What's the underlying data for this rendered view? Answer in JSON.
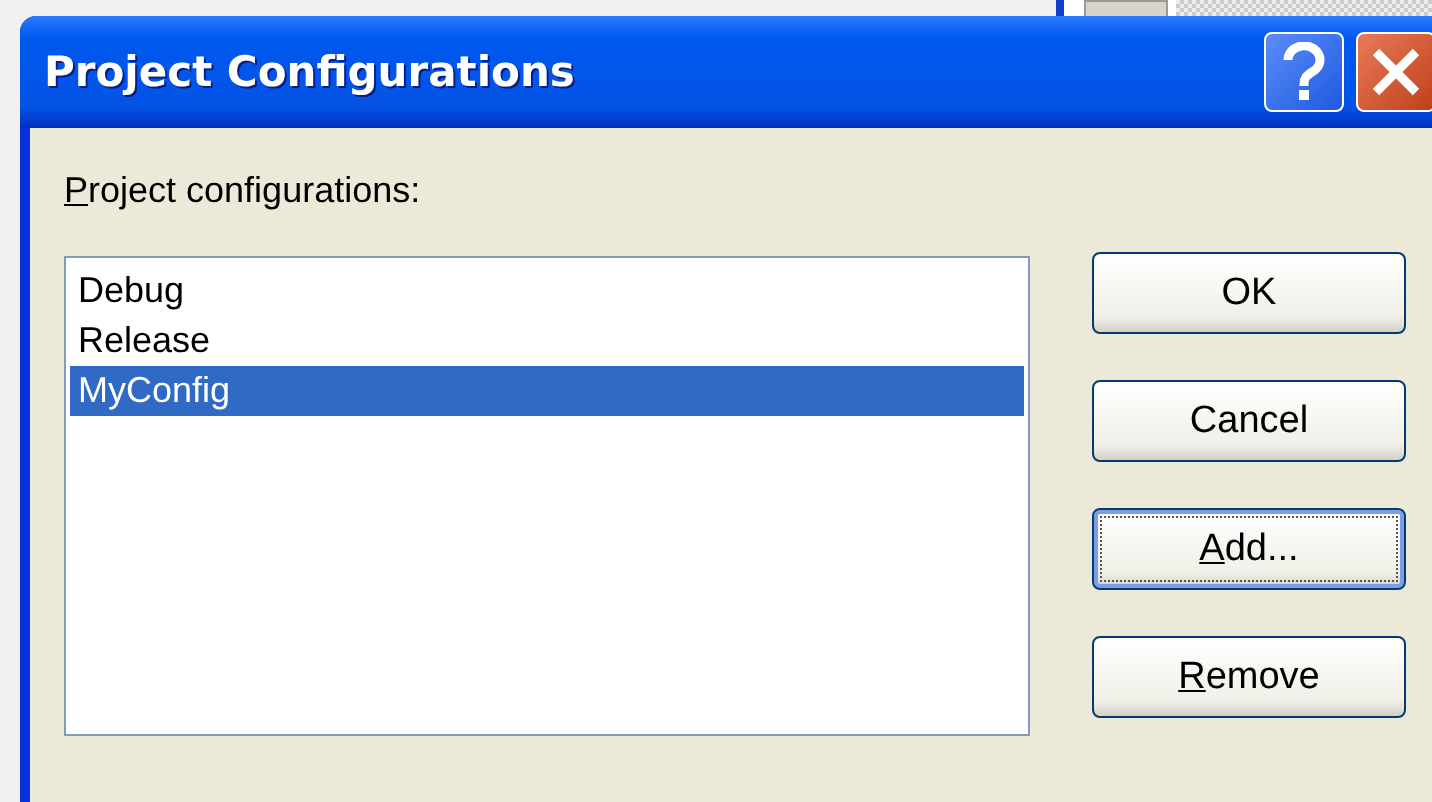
{
  "window": {
    "title": "Project Configurations"
  },
  "list_label": {
    "mnemonic": "P",
    "rest": "roject configurations:"
  },
  "configurations": [
    {
      "label": "Debug",
      "selected": false
    },
    {
      "label": "Release",
      "selected": false
    },
    {
      "label": "MyConfig",
      "selected": true
    }
  ],
  "buttons": [
    {
      "label": "OK",
      "focused": false
    },
    {
      "label": "Cancel",
      "focused": false
    },
    {
      "mnemonic": "A",
      "rest": "dd...",
      "focused": true
    },
    {
      "mnemonic": "R",
      "rest": "emove",
      "focused": false
    }
  ]
}
